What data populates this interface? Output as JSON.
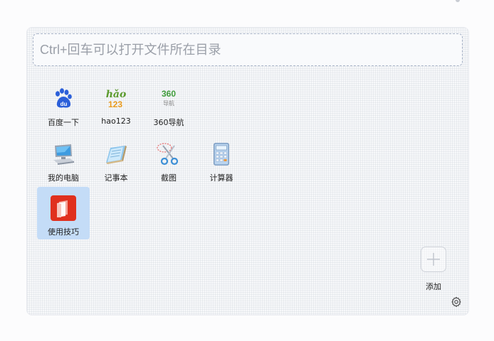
{
  "search": {
    "placeholder": "Ctrl+回车可以打开文件所在目录",
    "value": ""
  },
  "apps": [
    {
      "label": "百度一下",
      "icon": "baidu-icon",
      "selected": false
    },
    {
      "label": "hao123",
      "icon": "hao123-icon",
      "selected": false
    },
    {
      "label": "360导航",
      "icon": "360-nav-icon",
      "selected": false
    },
    {
      "label": "我的电脑",
      "icon": "computer-icon",
      "selected": false
    },
    {
      "label": "记事本",
      "icon": "notepad-icon",
      "selected": false
    },
    {
      "label": "截图",
      "icon": "scissors-icon",
      "selected": false
    },
    {
      "label": "计算器",
      "icon": "calculator-icon",
      "selected": false
    },
    {
      "label": "使用技巧",
      "icon": "tips-icon",
      "selected": true
    }
  ],
  "add": {
    "label": "添加",
    "icon": "plus-icon"
  },
  "settings": {
    "icon": "gear-icon"
  },
  "colors": {
    "selected_background": "#c4dcf7",
    "search_border": "#a9b4c8",
    "baidu_blue": "#2b5fd9",
    "hao123_green": "#5c9b2e",
    "hao123_orange": "#e89a1c",
    "tips_red": "#e0301e"
  }
}
